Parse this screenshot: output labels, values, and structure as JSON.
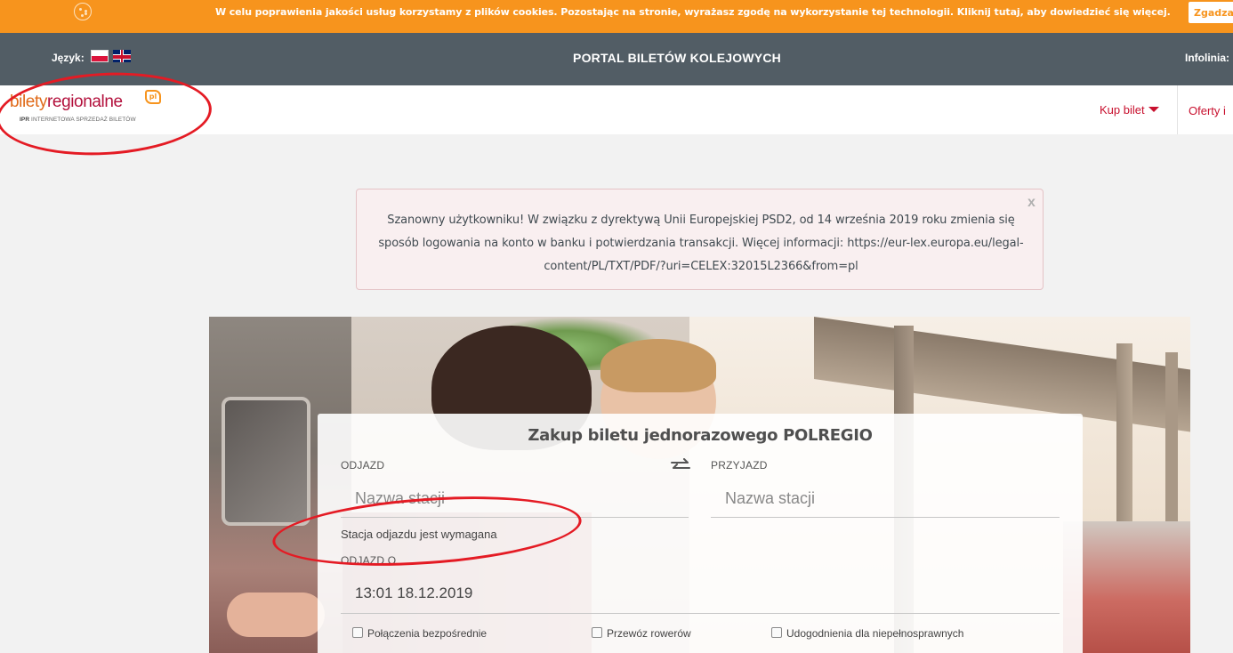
{
  "cookie_bar": {
    "text_before": "W celu poprawienia jakości usług korzystamy z plików cookies. Pozostając na stronie, wyrażasz zgodę na wykorzystanie tej technologii. Kliknij ",
    "link_label": "tutaj",
    "text_after": ", aby dowiedzieć się więcej.",
    "accept_button": "Zgadzam się"
  },
  "header": {
    "language_label": "Język:",
    "title": "PORTAL BILETÓW KOLEJOWYCH",
    "infolinia": "Infolinia:"
  },
  "logo": {
    "part1": "bilety",
    "part2": "regionalne",
    "badge": "pl",
    "sub_bold": "IPR",
    "sub_text": " INTERNETOWA SPRZEDAŻ BILETÓW"
  },
  "nav": {
    "buy_ticket": "Kup bilet",
    "offers": "Oferty i"
  },
  "alert": {
    "message": "Szanowny użytkowniku! W związku z dyrektywą Unii Europejskiej PSD2, od 14 września 2019 roku zmienia się sposób logowania na konto w banku i potwierdzania transakcji. Więcej informacji: https://eur-lex.europa.eu/legal-content/PL/TXT/PDF/?uri=CELEX:32015L2366&from=pl",
    "close": "x"
  },
  "booking": {
    "title": "Zakup biletu jednorazowego POLREGIO",
    "departure_label": "ODJAZD",
    "departure_placeholder": "Nazwa stacji",
    "arrival_label": "PRZYJAZD",
    "arrival_placeholder": "Nazwa stacji",
    "error": "Stacja odjazdu jest wymagana",
    "datetime_label": "ODJAZD O",
    "datetime_value": "13:01 18.12.2019",
    "options": [
      "Połączenia bezpośrednie",
      "Przewóz rowerów",
      "Udogodnienia dla niepełnosprawnych"
    ]
  },
  "colors": {
    "cookie_bar": "#f7941d",
    "header": "#525d65",
    "accent_red": "#c8102e",
    "annotation": "#e41b24"
  }
}
